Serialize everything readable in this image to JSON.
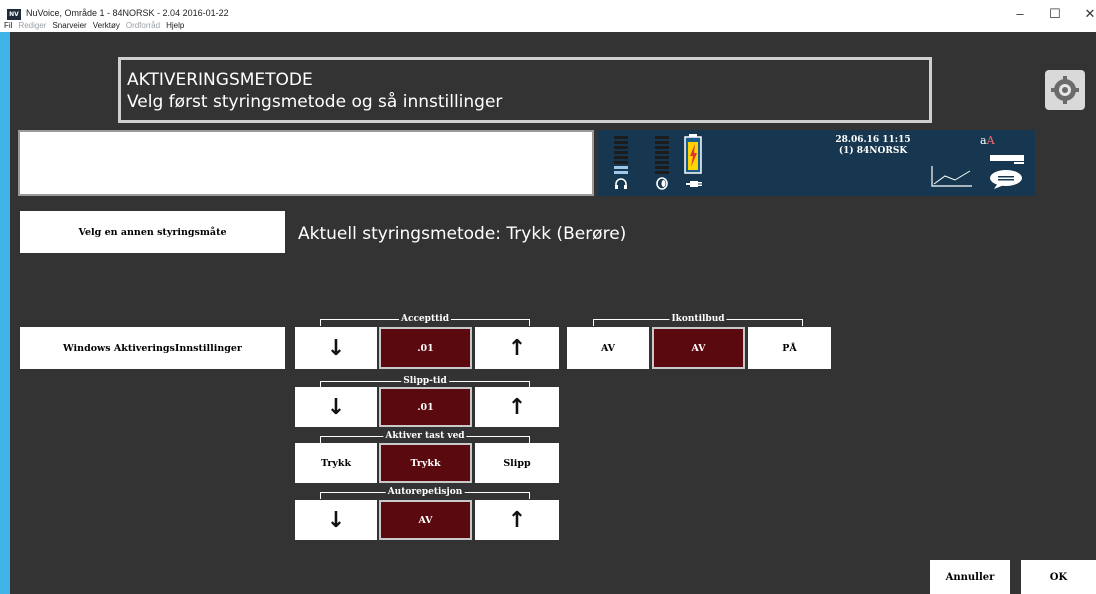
{
  "window": {
    "title": "NuVoice, Område 1 - 84NORSK - 2.04 2016-01-22",
    "app_icon_text": "NV",
    "controls": {
      "minimize": "–",
      "maximize": "☐",
      "close": "✕"
    }
  },
  "menu": [
    {
      "label": "Fil",
      "enabled": true
    },
    {
      "label": "Rediger",
      "enabled": false
    },
    {
      "label": "Snarveier",
      "enabled": true
    },
    {
      "label": "Verktøy",
      "enabled": true
    },
    {
      "label": "Ordforråd",
      "enabled": false
    },
    {
      "label": "Hjelp",
      "enabled": true
    }
  ],
  "header": {
    "title": "AKTIVERINGSMETODE",
    "subtitle": "Velg først styringsmetode og så innstillinger"
  },
  "status": {
    "datetime": "28.06.16 11:15",
    "user": "(1) 84NORSK",
    "font_icon_small": "a",
    "font_icon_big": "A"
  },
  "controls": {
    "choose_method_label": "Velg en annen styringsmåte",
    "current_method": "Aktuell styringsmetode: Trykk (Berøre)",
    "windows_settings_label": "Windows AktiveringsInnstillinger"
  },
  "groups": {
    "accept_time": {
      "label": "Accepttid",
      "value": ".01",
      "down": "↓",
      "up": "↑"
    },
    "release_time": {
      "label": "Slipp-tid",
      "value": ".01",
      "down": "↓",
      "up": "↑"
    },
    "activate_on": {
      "label": "Aktiver tast ved",
      "left": "Trykk",
      "value": "Trykk",
      "right": "Slipp"
    },
    "autorepeat": {
      "label": "Autorepetisjon",
      "value": "AV",
      "down": "↓",
      "up": "↑"
    },
    "icon_offer": {
      "label": "Ikontilbud",
      "left": "AV",
      "value": "AV",
      "right": "PÅ"
    }
  },
  "footer": {
    "cancel_label": "Annuller",
    "ok_label": "OK"
  },
  "colors": {
    "background": "#333333",
    "selected_value": "#5a0a0f",
    "status_panel": "#16374f",
    "accent_edge": "#3fb3e6"
  }
}
